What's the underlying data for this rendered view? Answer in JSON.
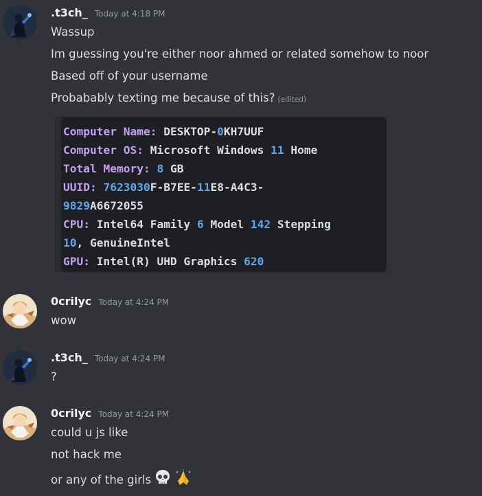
{
  "messages": [
    {
      "author": ".t3ch_",
      "time": "Today at 4:18 PM",
      "lines": [
        "Wassup",
        "Im guessing you're either noor ahmed or related somehow to noor",
        "Based off of your username",
        "Probabably texting me because of this?"
      ],
      "edited_tag": "(edited)",
      "code": {
        "computer_name_key": "Computer Name:",
        "computer_name_val_a": "DESKTOP-",
        "computer_name_val_num": "0",
        "computer_name_val_b": "KH7UUF",
        "os_key": "Computer OS:",
        "os_val_a": "Microsoft Windows",
        "os_val_num": "11",
        "os_val_b": "Home",
        "mem_key": "Total Memory:",
        "mem_val_num": "8",
        "mem_val_b": "GB",
        "uuid_key": "UUID:",
        "uuid_l1_num": "7623030",
        "uuid_l1_a": "F-B7EE-",
        "uuid_l1_num2": "11",
        "uuid_l1_b": "E8-A4C3-",
        "uuid_l2_num": "9829",
        "uuid_l2_b": "A6672055",
        "cpu_key": "CPU:",
        "cpu_val_a": "Intel64 Family",
        "cpu_val_num1": "6",
        "cpu_val_b": "Model",
        "cpu_val_num2": "142",
        "cpu_val_c": "Stepping",
        "cpu_l2_num": "10",
        "cpu_l2_b": ", GenuineIntel",
        "gpu_key": "GPU:",
        "gpu_val_a": "Intel(R) UHD Graphics",
        "gpu_val_num": "620"
      }
    },
    {
      "author": "0crilyc",
      "time": "Today at 4:24 PM",
      "lines": [
        "wow"
      ]
    },
    {
      "author": ".t3ch_",
      "time": "Today at 4:24 PM",
      "lines": [
        "?"
      ]
    },
    {
      "author": "0crilyc",
      "time": "Today at 4:24 PM",
      "lines": [
        "could u js like",
        "not hack me",
        "or any of the girls"
      ],
      "emojis": [
        "skull-emoji",
        "folded-hands-emoji"
      ]
    }
  ],
  "colors": {
    "background": "#313338",
    "code_key": "#c49ef3",
    "code_number": "#59a8f0"
  }
}
